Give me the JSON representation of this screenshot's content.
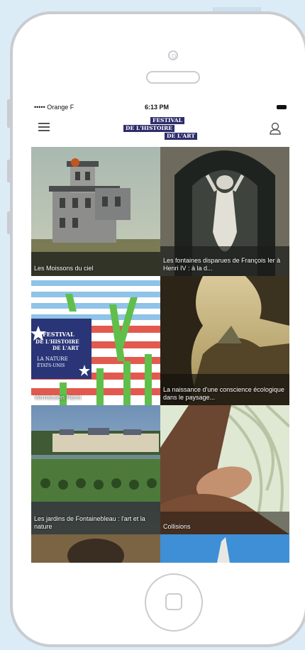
{
  "status_bar": {
    "carrier": "••••• Orange F",
    "time": "6:13 PM"
  },
  "header": {
    "logo_lines": [
      "FESTIVAL",
      "DE L'HISTOIRE",
      "DE L'ART"
    ]
  },
  "tiles": [
    {
      "label": "Les Moissons du ciel"
    },
    {
      "label": "Les fontaines disparues de François Ier à Henri IV : à la d..."
    },
    {
      "label": "Vermeulen Remi"
    },
    {
      "label": "La naissance d'une conscience écologique dans le paysage..."
    },
    {
      "label": "Les jardins de Fontainebleau : l'art et la nature"
    },
    {
      "label": "Collisions"
    }
  ],
  "poster": {
    "line1": "FESTIVAL",
    "line2": "DE L'HISTOIRE",
    "line3": "DE L'ART",
    "line4": "LA NATURE",
    "line5": "ÉTATS-UNIS"
  },
  "colors": {
    "logo_bg": "#2e2d6b",
    "frame": "#c9ccd0",
    "background": "#dcecf7"
  },
  "icons": [
    "menu-icon",
    "user-icon",
    "home-button"
  ]
}
